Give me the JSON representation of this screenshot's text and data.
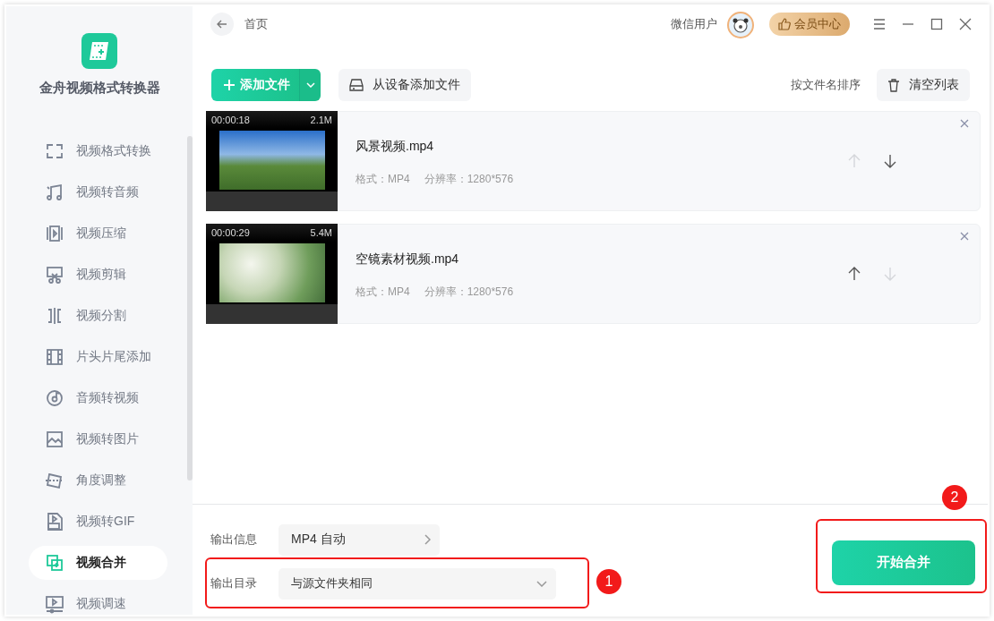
{
  "app": {
    "name": "金舟视频格式转换器"
  },
  "sidebar": {
    "items": [
      {
        "label": "视频格式转换",
        "selected": false
      },
      {
        "label": "视频转音频",
        "selected": false
      },
      {
        "label": "视频压缩",
        "selected": false
      },
      {
        "label": "视频剪辑",
        "selected": false
      },
      {
        "label": "视频分割",
        "selected": false
      },
      {
        "label": "片头片尾添加",
        "selected": false
      },
      {
        "label": "音频转视频",
        "selected": false
      },
      {
        "label": "视频转图片",
        "selected": false
      },
      {
        "label": "角度调整",
        "selected": false
      },
      {
        "label": "视频转GIF",
        "selected": false
      },
      {
        "label": "视频合并",
        "selected": true
      },
      {
        "label": "视频调速",
        "selected": false
      }
    ]
  },
  "header": {
    "breadcrumb": "首页",
    "user": "微信用户",
    "vip_button": "会员中心"
  },
  "toolbar": {
    "add_file": "添加文件",
    "add_from_device": "从设备添加文件",
    "sort": "按文件名排序",
    "clear": "清空列表"
  },
  "files": [
    {
      "name": "风景视频.mp4",
      "duration": "00:00:18",
      "size": "2.1M",
      "format": "格式：MP4",
      "resolution": "分辨率：1280*576",
      "up_disabled": true,
      "down_disabled": false
    },
    {
      "name": "空镜素材视频.mp4",
      "duration": "00:00:29",
      "size": "5.4M",
      "format": "格式：MP4",
      "resolution": "分辨率：1280*576",
      "up_disabled": false,
      "down_disabled": true
    }
  ],
  "output": {
    "info_label": "输出信息",
    "info_value": "MP4 自动",
    "dir_label": "输出目录",
    "dir_value": "与源文件夹相同"
  },
  "start_button": "开始合并",
  "annotations": [
    {
      "label": "1"
    },
    {
      "label": "2"
    }
  ]
}
